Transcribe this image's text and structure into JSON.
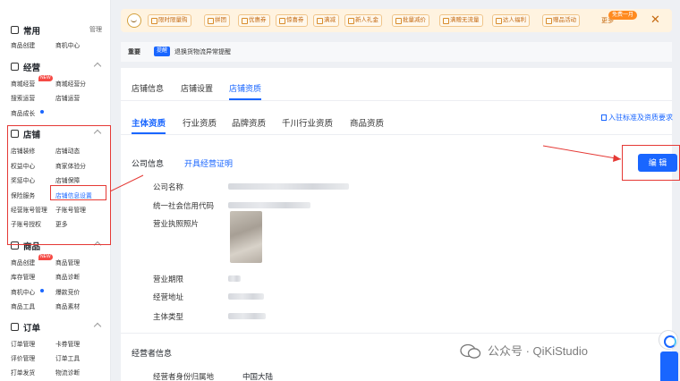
{
  "sidebar": {
    "sections": [
      {
        "title": "常用",
        "extra": "管理",
        "items": [
          "商品创建",
          "商机中心"
        ]
      },
      {
        "title": "经营",
        "items": [
          "商城经营",
          "商城经营分",
          "搜索运营",
          "店铺运营",
          "商品成长"
        ],
        "badge": "NEW"
      },
      {
        "title": "店铺",
        "items": [
          "店铺装修",
          "店铺动态",
          "权益中心",
          "商家体验分",
          "奖惩中心",
          "店铺保障",
          "保险服务",
          "店铺信息设置",
          "经营账号管理",
          "子账号管理",
          "子账号授权",
          "更多"
        ]
      },
      {
        "title": "商品",
        "items": [
          "商品创建",
          "商品管理",
          "库存管理",
          "商品诊断",
          "商机中心",
          "爆款竞价",
          "商品工具",
          "商品素材"
        ],
        "badge": "NEW"
      },
      {
        "title": "订单",
        "items": [
          "订单管理",
          "卡券管理",
          "评价管理",
          "订单工具",
          "打单发货",
          "物流诊断"
        ]
      }
    ]
  },
  "banner": {
    "chips": [
      "限时限量购",
      "拼团",
      "优惠券",
      "惊喜券",
      "满减",
      "新人礼金",
      "批量减价",
      "满赠无流量",
      "达人福利",
      "赠品活动"
    ],
    "more_label": "更多",
    "trial_label": "免费一月",
    "close": "✕"
  },
  "notice": {
    "label": "重要",
    "tag": "提醒",
    "text": "退换货物流异常提醒"
  },
  "tabs": [
    "店铺信息",
    "店铺设置",
    "店铺资质"
  ],
  "active_tab": "店铺资质",
  "subtabs": [
    "主体资质",
    "行业资质",
    "品牌资质",
    "千川行业资质",
    "商品资质"
  ],
  "right_link": "入驻标准及资质要求",
  "company": {
    "section_title": "公司信息",
    "cert_link": "开具经营证明",
    "edit_label": "编 辑",
    "labels": [
      "公司名称",
      "统一社会信用代码",
      "营业执照照片",
      "营业期限",
      "经营地址",
      "主体类型"
    ]
  },
  "operator": {
    "section_title": "经营者信息",
    "region_label": "经营者身份归属地",
    "region_value": "中国大陆"
  },
  "watermark": "公众号 · QiKiStudio"
}
